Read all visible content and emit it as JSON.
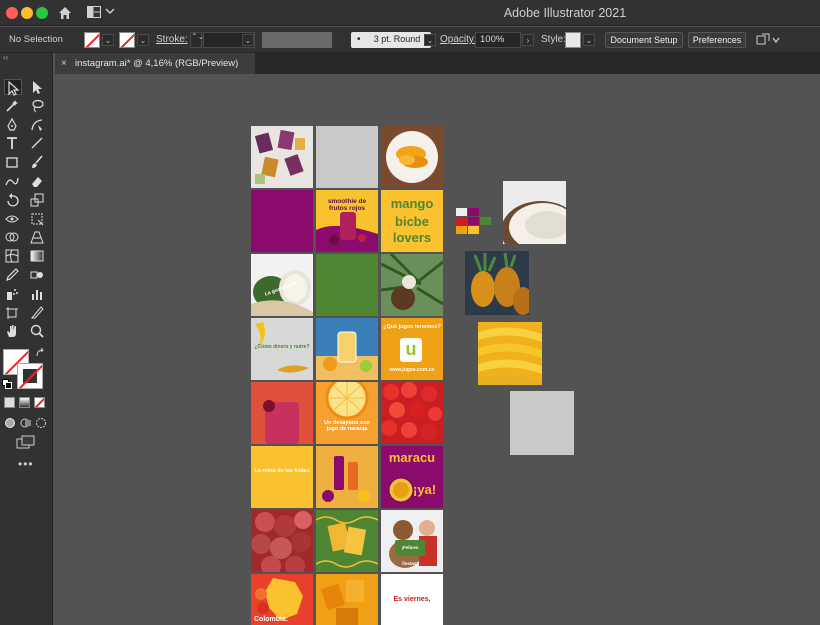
{
  "titlebar": {
    "app_title": "Adobe Illustrator 2021"
  },
  "controlbar": {
    "selection": "No Selection",
    "stroke_label": "Stroke:",
    "stroke_profile": "3 pt. Round",
    "opacity_label": "Opacity:",
    "opacity_value": "100%",
    "style_label": "Style:",
    "document_setup": "Document Setup",
    "preferences": "Preferences"
  },
  "document": {
    "tab_title": "instagram.ai* @ 4,16% (RGB/Preview)"
  },
  "tools": [
    "selection-tool",
    "direct-selection-tool",
    "magic-wand-tool",
    "lasso-tool",
    "pen-tool",
    "curvature-tool",
    "type-tool",
    "line-tool",
    "rectangle-tool",
    "paintbrush-tool",
    "shaper-tool",
    "eraser-tool",
    "rotate-tool",
    "scale-tool",
    "width-tool",
    "free-transform-tool",
    "shape-builder-tool",
    "perspective-grid-tool",
    "mesh-tool",
    "gradient-tool",
    "eyedropper-tool",
    "blend-tool",
    "symbol-sprayer-tool",
    "column-graph-tool",
    "artboard-tool",
    "slice-tool",
    "hand-tool",
    "zoom-tool"
  ],
  "posts": {
    "smoothie": "smoothie de frutos rojos",
    "mango_top": "mango",
    "mango_mid": "bicbe",
    "mango_bot": "lovers",
    "guanabana": "La guanábana",
    "banana_q": "¿Cómo dinero y nutre?",
    "jugos_top": "¿Qué jugos tenemos?",
    "jugos_web": "www.jugos.com.co",
    "jugo_naranja": "Un desayuno con jugo de naranja",
    "reina": "La reina de las frutas",
    "maracu": "maracu",
    "ya": "¡ya!",
    "felices": "¡Felices fiestas!",
    "colombia": "Colombia:",
    "viernes": "Es viernes,"
  },
  "colors": {
    "purple": "#8b0a6b",
    "green": "#4f8633",
    "yellow": "#f9c22e",
    "orange": "#f0a014",
    "red": "#e2262b",
    "gray": "#c9c9c9"
  }
}
